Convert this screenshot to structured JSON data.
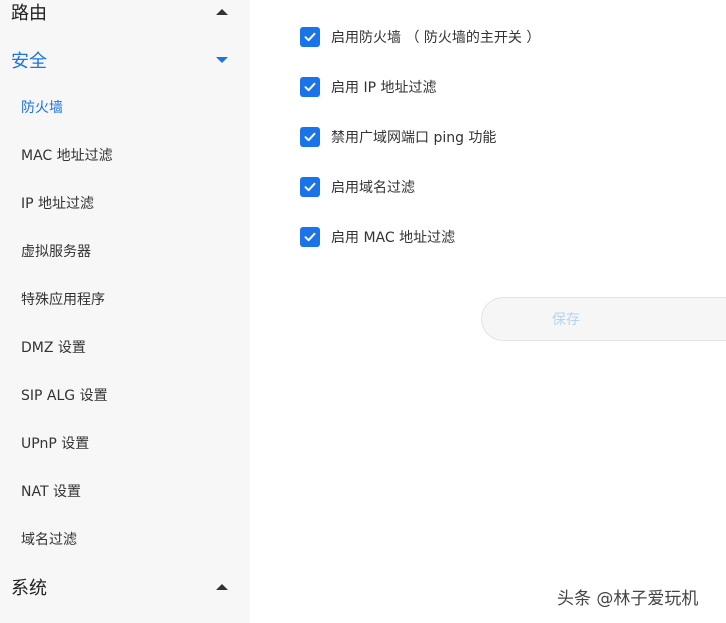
{
  "sidebar": {
    "routing": {
      "label": "路由"
    },
    "security": {
      "label": "安全",
      "items": [
        {
          "label": "防火墙"
        },
        {
          "label": "MAC 地址过滤"
        },
        {
          "label": "IP 地址过滤"
        },
        {
          "label": "虚拟服务器"
        },
        {
          "label": "特殊应用程序"
        },
        {
          "label": "DMZ 设置"
        },
        {
          "label": "SIP ALG 设置"
        },
        {
          "label": "UPnP 设置"
        },
        {
          "label": "NAT 设置"
        },
        {
          "label": "域名过滤"
        }
      ]
    },
    "system": {
      "label": "系统"
    }
  },
  "main": {
    "options": [
      {
        "label": "启用防火墙 （ 防火墙的主开关 ）",
        "checked": true
      },
      {
        "label": "启用 IP 地址过滤",
        "checked": true
      },
      {
        "label": "禁用广域网端口 ping 功能",
        "checked": true
      },
      {
        "label": "启用域名过滤",
        "checked": true
      },
      {
        "label": "启用 MAC 地址过滤",
        "checked": true
      }
    ],
    "save_label": "保存"
  },
  "watermark": "头条 @林子爱玩机",
  "colors": {
    "accent": "#1a73e8",
    "sidebar_bg": "#f7f7f8"
  }
}
